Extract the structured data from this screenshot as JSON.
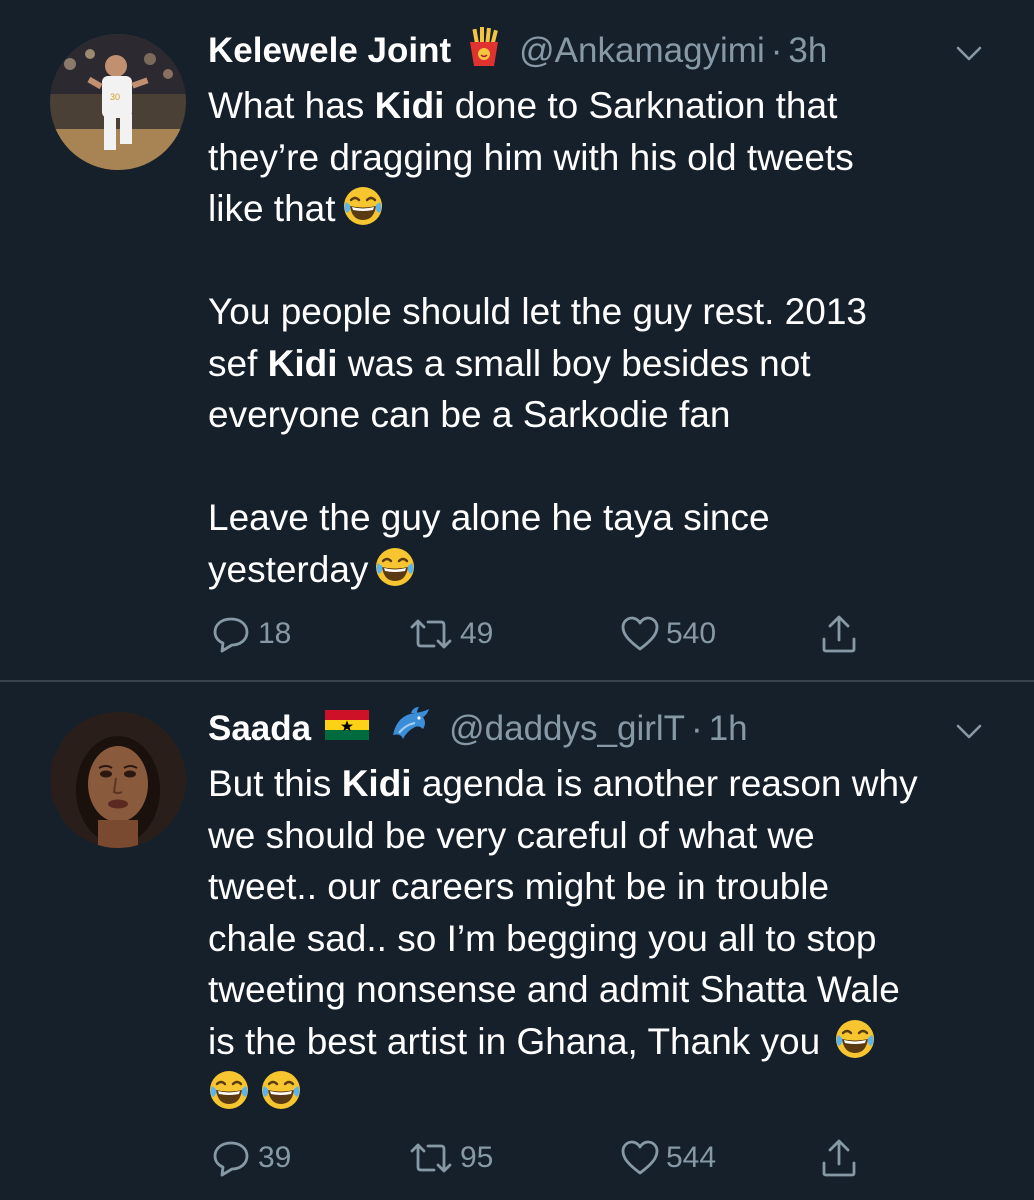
{
  "tweets": [
    {
      "display_name": "Kelewele Joint",
      "name_emoji_icon": "french-fries-icon",
      "handle": "@Ankamagyimi",
      "separator": "·",
      "time": "3h",
      "text": {
        "l1a": "What has ",
        "l1b": "Kidi",
        "l1c": " done to Sarknation that",
        "l2": "they’re dragging him with his old tweets",
        "l3": "like that",
        "l5": "You people should let the guy rest. 2013",
        "l6a": "sef ",
        "l6b": "Kidi",
        "l6c": " was a small boy besides not",
        "l7": "everyone can be a Sarkodie fan",
        "l9": "Leave the guy alone he taya since",
        "l10": "yesterday"
      },
      "replies": "18",
      "retweets": "49",
      "likes": "540"
    },
    {
      "display_name": "Saada",
      "name_emoji_icons": [
        "ghana-flag-icon",
        "dolphin-icon"
      ],
      "handle": "@daddys_girlT",
      "separator": "·",
      "time": "1h",
      "text": {
        "l1a": "But this ",
        "l1b": "Kidi",
        "l1c": " agenda is another reason why",
        "l2": "we should be very careful of what we",
        "l3": "tweet.. our careers might be in trouble",
        "l4": "chale sad.. so I’m begging you all to stop",
        "l5": "tweeting nonsense and admit Shatta Wale",
        "l6": "is the best artist in Ghana, Thank you"
      },
      "replies": "39",
      "retweets": "95",
      "likes": "544"
    }
  ],
  "colors": {
    "background": "#15202b",
    "secondary_text": "#8899a6",
    "divider": "#38444d",
    "primary_text": "#ffffff"
  }
}
